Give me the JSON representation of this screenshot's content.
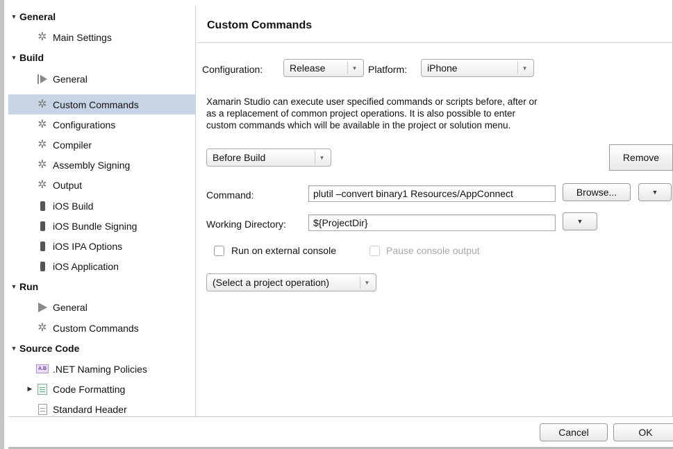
{
  "sidebar": {
    "sections": [
      {
        "label": "General",
        "items": [
          {
            "label": "Main Settings",
            "icon": "gear-icon"
          }
        ]
      },
      {
        "label": "Build",
        "items": [
          {
            "label": "General",
            "icon": "run-general-icon"
          },
          {
            "label": "Custom Commands",
            "icon": "gear-icon",
            "selected": true
          },
          {
            "label": "Configurations",
            "icon": "gear-icon"
          },
          {
            "label": "Compiler",
            "icon": "gear-icon"
          },
          {
            "label": "Assembly Signing",
            "icon": "gear-icon"
          },
          {
            "label": "Output",
            "icon": "gear-icon"
          },
          {
            "label": "iOS Build",
            "icon": "phone-icon"
          },
          {
            "label": "iOS Bundle Signing",
            "icon": "phone-icon"
          },
          {
            "label": "iOS IPA Options",
            "icon": "phone-icon"
          },
          {
            "label": "iOS Application",
            "icon": "phone-icon"
          }
        ]
      },
      {
        "label": "Run",
        "items": [
          {
            "label": "General",
            "icon": "play-icon"
          },
          {
            "label": "Custom Commands",
            "icon": "gear-icon"
          }
        ]
      },
      {
        "label": "Source Code",
        "items": [
          {
            "label": ".NET Naming Policies",
            "icon": "naming-policy-icon"
          },
          {
            "label": "Code Formatting",
            "icon": "code-formatting-icon",
            "collapsed": true
          },
          {
            "label": "Standard Header",
            "icon": "document-icon"
          }
        ]
      }
    ],
    "selection_color": "#c7d4e5"
  },
  "main": {
    "title": "Custom Commands",
    "configuration_label": "Configuration:",
    "configuration_value": "Release",
    "platform_label": "Platform:",
    "platform_value": "iPhone",
    "description_lines": [
      "Xamarin Studio can execute user specified commands or scripts before, after or",
      "as a replacement of common project operations. It is also possible to enter",
      "custom commands which will be available in the project or solution menu."
    ],
    "operation_value": "Before Build",
    "remove_label": "Remove",
    "command_label": "Command:",
    "command_value": "plutil –convert binary1 Resources/AppConnect",
    "browse_label": "Browse...",
    "working_dir_label": "Working Directory:",
    "working_dir_value": "${ProjectDir}",
    "run_external_label": "Run on external console",
    "pause_output_label": "Pause console output",
    "select_operation_value": "(Select a project operation)"
  },
  "footer": {
    "cancel_label": "Cancel",
    "ok_label": "OK"
  }
}
